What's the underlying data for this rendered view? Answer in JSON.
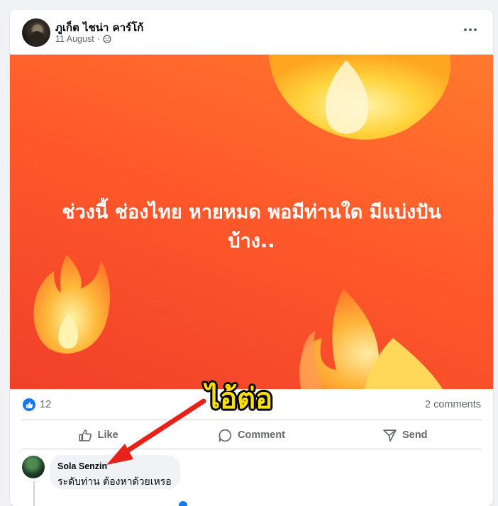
{
  "post": {
    "author": "ภูเก็ต ไชน่า คาร์โก้",
    "date": "11 August",
    "separator": "·",
    "privacy_icon": "public-globe-icon",
    "banner_text_line1": "ช่วงนี้ ช่องไทย หายหมด พอมีท่านใด มีแบ่งปัน",
    "banner_text_line2": "บ้าง..",
    "banner_colors": {
      "top": "#ff7a2e",
      "bottom": "#f0402a"
    }
  },
  "stats": {
    "likes": "12",
    "comments": "2 comments"
  },
  "actions": {
    "like_label": "Like",
    "comment_label": "Comment",
    "send_label": "Send"
  },
  "comment": {
    "author": "Sola Senzin",
    "text": "ระดับท่าน ต้องหาด้วยเหรอ"
  },
  "annotation": {
    "text": "ไอ้ต่อ",
    "color": "#ffe000",
    "arrow_color": "#e8211b"
  },
  "colors": {
    "accent": "#1877f2",
    "muted": "#65676b"
  }
}
